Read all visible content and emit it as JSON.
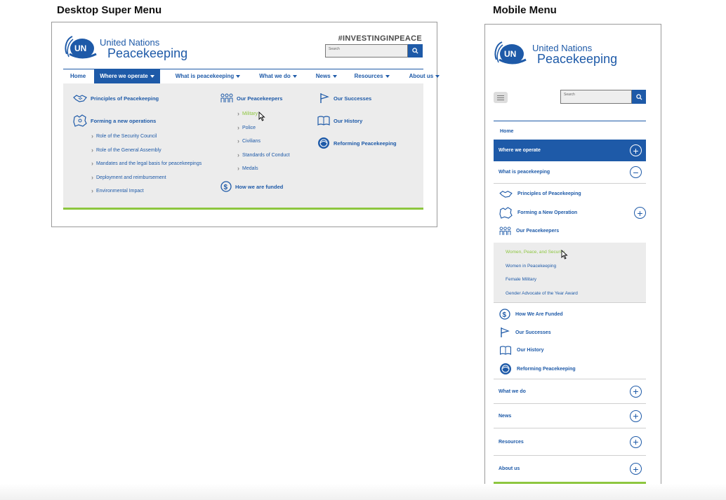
{
  "titles": {
    "desktop": "Desktop Super Menu",
    "mobile": "Mobile Menu"
  },
  "brand": {
    "badge": "UN",
    "line1": "United Nations",
    "line2": "Peacekeeping"
  },
  "desktop": {
    "hashtag": "#INVESTINGINPEACE",
    "search_placeholder": "Search",
    "nav": [
      "Home",
      "Where we operate",
      "What is peacekeeping",
      "What we do",
      "News",
      "Resources",
      "About us"
    ],
    "col1": {
      "principles": "Principles of Peacekeeping",
      "forming": "Forming a new operations",
      "subs": [
        "Role of the Security Council",
        "Role of the General Assembly",
        "Mandates and the legal basis for peacekeepings",
        "Deployment and reimbursement",
        "Environmental Impact"
      ]
    },
    "col2": {
      "peacekeepers": "Our Peacekeepers",
      "subs": [
        "Military",
        "Police",
        "Civilians",
        "Standards of Conduct",
        "Medals"
      ],
      "funded": "How we are funded"
    },
    "col3": {
      "successes": "Our Successes",
      "history": "Our History",
      "reforming": "Reforming Peacekeeping"
    }
  },
  "mobile": {
    "search_placeholder": "Search",
    "home": "Home",
    "where": "Where we operate",
    "what_is": "What is peacekeeping",
    "principles": "Principles of Peacekeeping",
    "forming": "Forming a New Operation",
    "peacekeepers": "Our Peacekeepers",
    "grey": [
      "Women, Peace, and Security",
      "Women in Peacekeeping",
      "Female Military",
      "Gender Advocate of the Year Award"
    ],
    "funded": "How We Are Funded",
    "successes": "Our Successes",
    "history": "Our History",
    "reforming": "Reforming Peacekeeping",
    "what_we_do": "What we do",
    "news": "News",
    "resources": "Resources",
    "about": "About us"
  },
  "colors": {
    "brand_blue": "#1e5aa8",
    "accent_green": "#8dc63f",
    "panel_grey": "#ececec"
  }
}
